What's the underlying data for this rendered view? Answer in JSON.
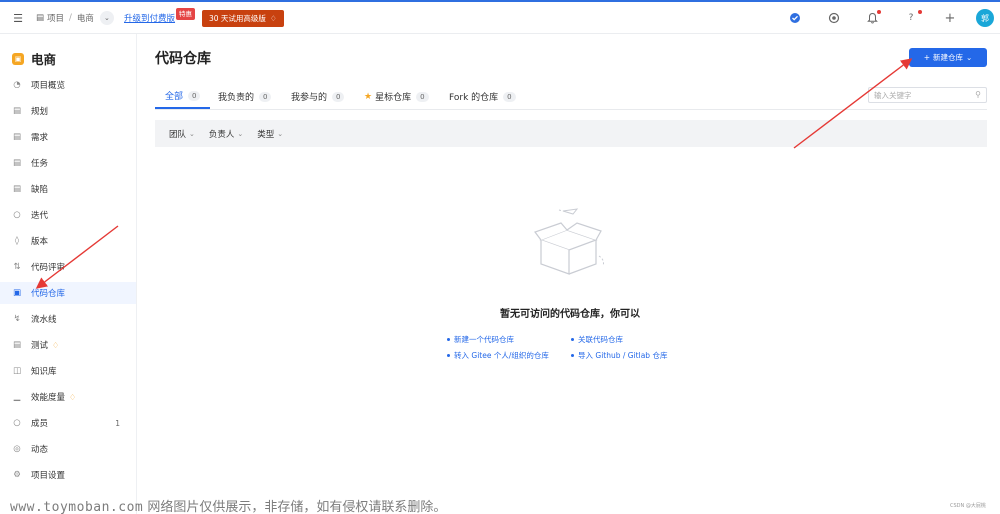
{
  "header": {
    "breadcrumb": {
      "project": "项目",
      "separator": "/",
      "current": "电商"
    },
    "upgrade_link": "升级到付费版",
    "sale_tag": "特惠",
    "trial_button": "30 天试用高级版",
    "avatar_initial": "郭"
  },
  "sidebar": {
    "project_name": "电商",
    "items": [
      {
        "label": "项目概览",
        "icon": "gauge-icon"
      },
      {
        "label": "规划",
        "icon": "plan-icon"
      },
      {
        "label": "需求",
        "icon": "requirement-icon"
      },
      {
        "label": "任务",
        "icon": "task-icon"
      },
      {
        "label": "缺陷",
        "icon": "bug-icon"
      },
      {
        "label": "迭代",
        "icon": "iteration-icon"
      },
      {
        "label": "版本",
        "icon": "layers-icon"
      },
      {
        "label": "代码评审",
        "icon": "review-icon"
      },
      {
        "label": "代码仓库",
        "icon": "code-icon",
        "active": true
      },
      {
        "label": "流水线",
        "icon": "pipeline-icon"
      },
      {
        "label": "测试",
        "icon": "test-icon",
        "premium": true
      },
      {
        "label": "知识库",
        "icon": "book-icon"
      },
      {
        "label": "效能度量",
        "icon": "chart-icon",
        "premium": true
      },
      {
        "label": "成员",
        "icon": "members-icon",
        "count": "1"
      },
      {
        "label": "动态",
        "icon": "activity-icon"
      },
      {
        "label": "项目设置",
        "icon": "settings-icon"
      }
    ]
  },
  "main": {
    "title": "代码仓库",
    "new_button": "新建仓库",
    "tabs": [
      {
        "label": "全部",
        "count": "0",
        "active": true
      },
      {
        "label": "我负责的",
        "count": "0"
      },
      {
        "label": "我参与的",
        "count": "0"
      },
      {
        "label": "星标仓库",
        "count": "0",
        "star": true
      },
      {
        "label": "Fork 的仓库",
        "count": "0"
      }
    ],
    "search_placeholder": "输入关键字",
    "filters": [
      "团队",
      "负责人",
      "类型"
    ],
    "empty": {
      "title": "暂无可访问的代码仓库，你可以",
      "links": [
        "新建一个代码仓库",
        "关联代码仓库",
        "转入 Gitee 个人/组织的仓库",
        "导入 Github / Gitlab 仓库"
      ]
    }
  },
  "footer": {
    "watermark_host": "www.toymoban.com",
    "watermark_text": "网络图片仅供展示，非存储，如有侵权请联系删除。",
    "credit": "CSDN @大屁桃"
  },
  "colors": {
    "accent": "#2468e8",
    "annotation_arrow": "#e53935",
    "trial": "#c8410f"
  }
}
